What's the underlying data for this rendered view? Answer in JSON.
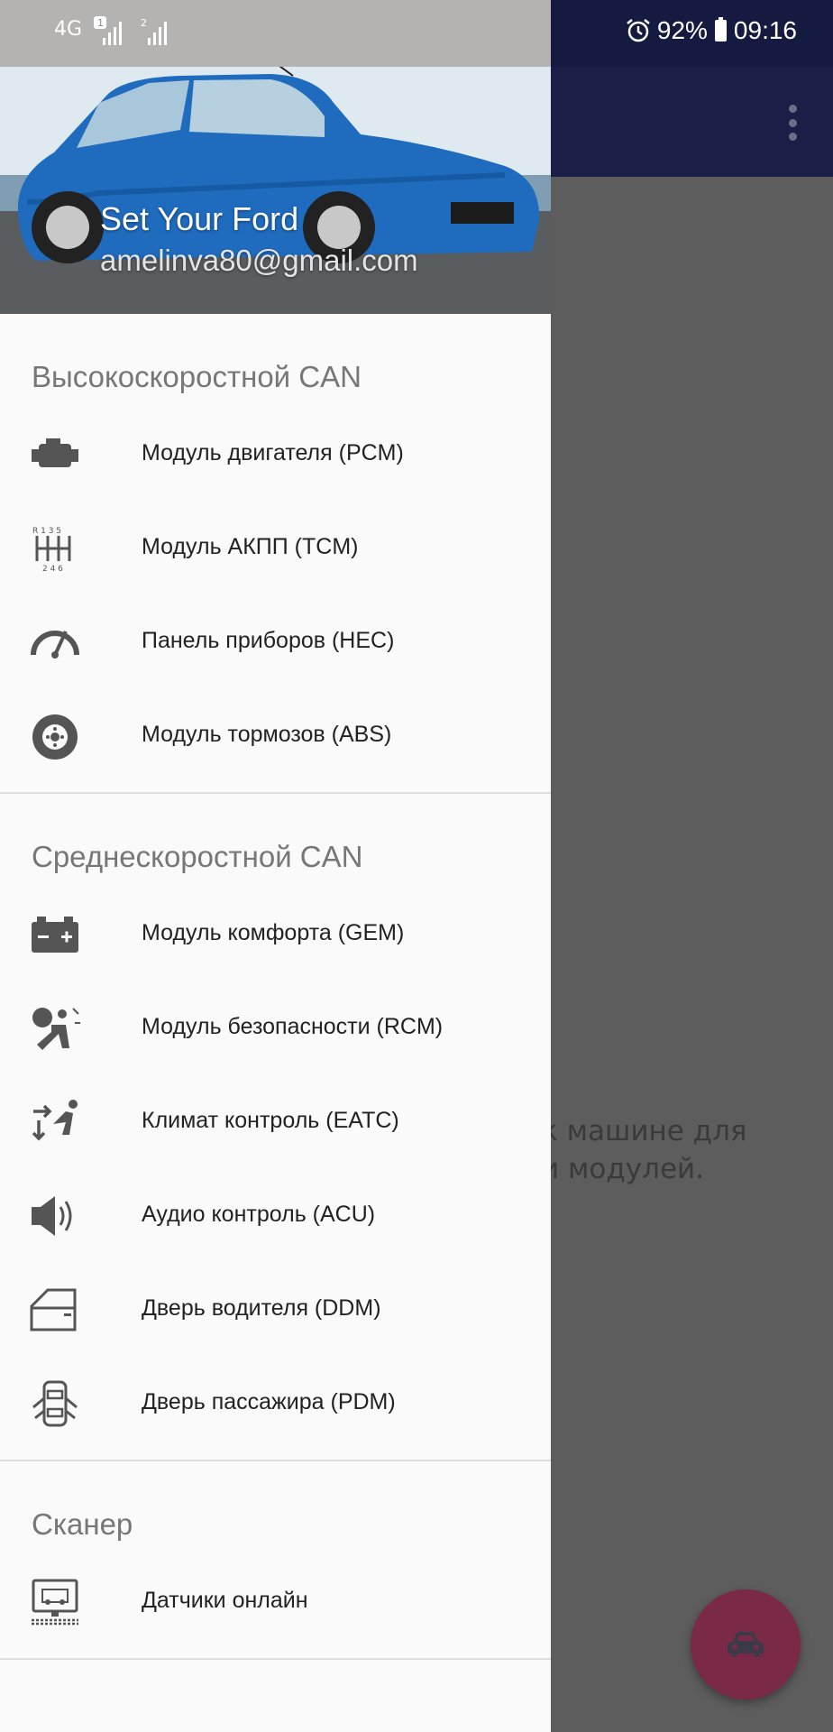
{
  "status_bar": {
    "network": "4G",
    "sim1": "1",
    "sim2": "2",
    "battery": "92%",
    "time": "09:16"
  },
  "drawer": {
    "header": {
      "title": "Set Your Ford",
      "email": "amelinva80@gmail.com"
    },
    "sections": [
      {
        "title": "Высокоскоростной CAN",
        "items": [
          {
            "label": "Модуль двигателя (PCM)",
            "icon": "engine-icon"
          },
          {
            "label": "Модуль АКПП (TCM)",
            "icon": "gearbox-icon"
          },
          {
            "label": "Панель приборов (HEC)",
            "icon": "speedometer-icon"
          },
          {
            "label": "Модуль тормозов (ABS)",
            "icon": "brake-disc-icon"
          }
        ]
      },
      {
        "title": "Среднескоростной CAN",
        "items": [
          {
            "label": "Модуль комфорта (GEM)",
            "icon": "battery-icon"
          },
          {
            "label": "Модуль безопасности (RCM)",
            "icon": "airbag-icon"
          },
          {
            "label": "Климат контроль (EATC)",
            "icon": "climate-icon"
          },
          {
            "label": "Аудио контроль (ACU)",
            "icon": "speaker-icon"
          },
          {
            "label": "Дверь водителя (DDM)",
            "icon": "door-icon"
          },
          {
            "label": "Дверь пассажира (PDM)",
            "icon": "car-doors-icon"
          }
        ]
      },
      {
        "title": "Сканер",
        "items": [
          {
            "label": "Датчики онлайн",
            "icon": "monitor-icon"
          }
        ]
      }
    ]
  },
  "background": {
    "message": "к машине для\nи модулей."
  },
  "colors": {
    "toolbar": "#1a1f47",
    "fab": "#7a2a47",
    "drawer_bg": "#fafafa"
  }
}
